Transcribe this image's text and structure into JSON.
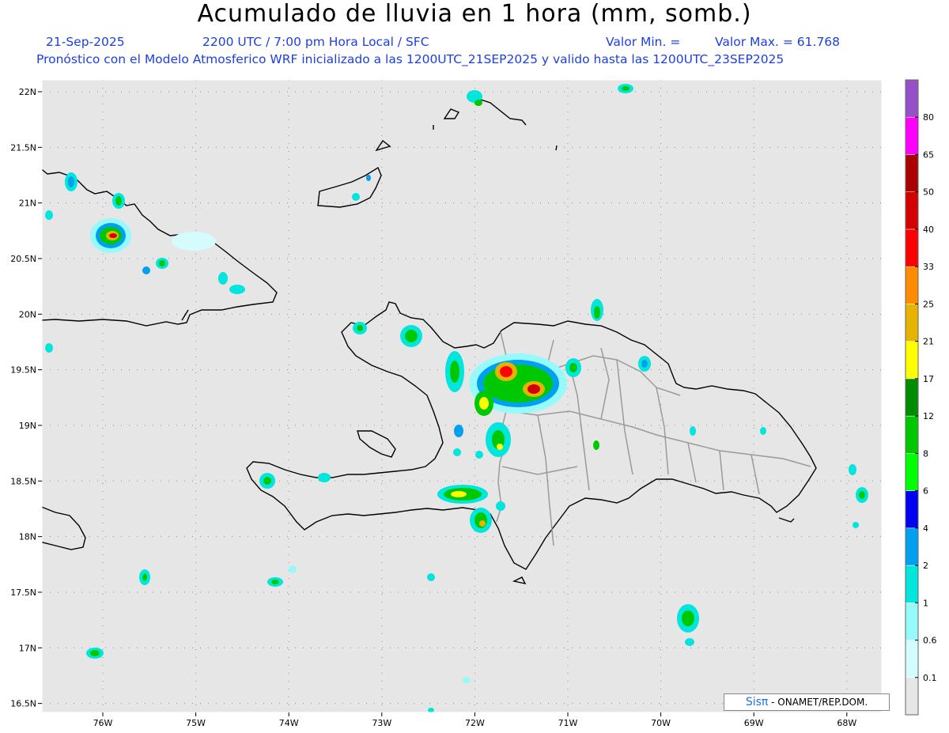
{
  "header": {
    "title": "Acumulado de lluvia en 1 hora (mm, somb.)",
    "date": "21-Sep-2025",
    "valid_time": "2200 UTC / 7:00 pm Hora Local / SFC",
    "min_label": "Valor Min. =",
    "max_label": "Valor Max. = 61.768",
    "forecast_line": "Pronóstico con el Modelo Atmosferico WRF inicializado a las 1200UTC_21SEP2025 y valido hasta las  1200UTC_23SEP2025"
  },
  "map": {
    "lat_labels": [
      "22N",
      "21.5N",
      "21N",
      "20.5N",
      "20N",
      "19.5N",
      "19N",
      "18.5N",
      "18N",
      "17.5N",
      "17N",
      "16.5N"
    ],
    "lon_labels": [
      "76W",
      "75W",
      "74W",
      "73W",
      "72W",
      "71W",
      "70W",
      "69W",
      "68W"
    ],
    "background_color": "#e6e6e6"
  },
  "legend": {
    "levels": [
      "0.1",
      "0.6",
      "1",
      "2",
      "4",
      "6",
      "8",
      "12",
      "17",
      "21",
      "25",
      "33",
      "40",
      "50",
      "65",
      "80"
    ],
    "colors": [
      "#e6e6e6",
      "#d4fcfc",
      "#96fafa",
      "#00e6dc",
      "#00a0f0",
      "#0000f0",
      "#00ff00",
      "#00c800",
      "#008c00",
      "#ffff00",
      "#e6b400",
      "#ff8c00",
      "#ff0000",
      "#d20000",
      "#aa0000",
      "#ff00ff",
      "#9650c8"
    ]
  },
  "credit": {
    "brand": "Sisπ",
    "text": " - ONAMET/REP.DOM."
  }
}
